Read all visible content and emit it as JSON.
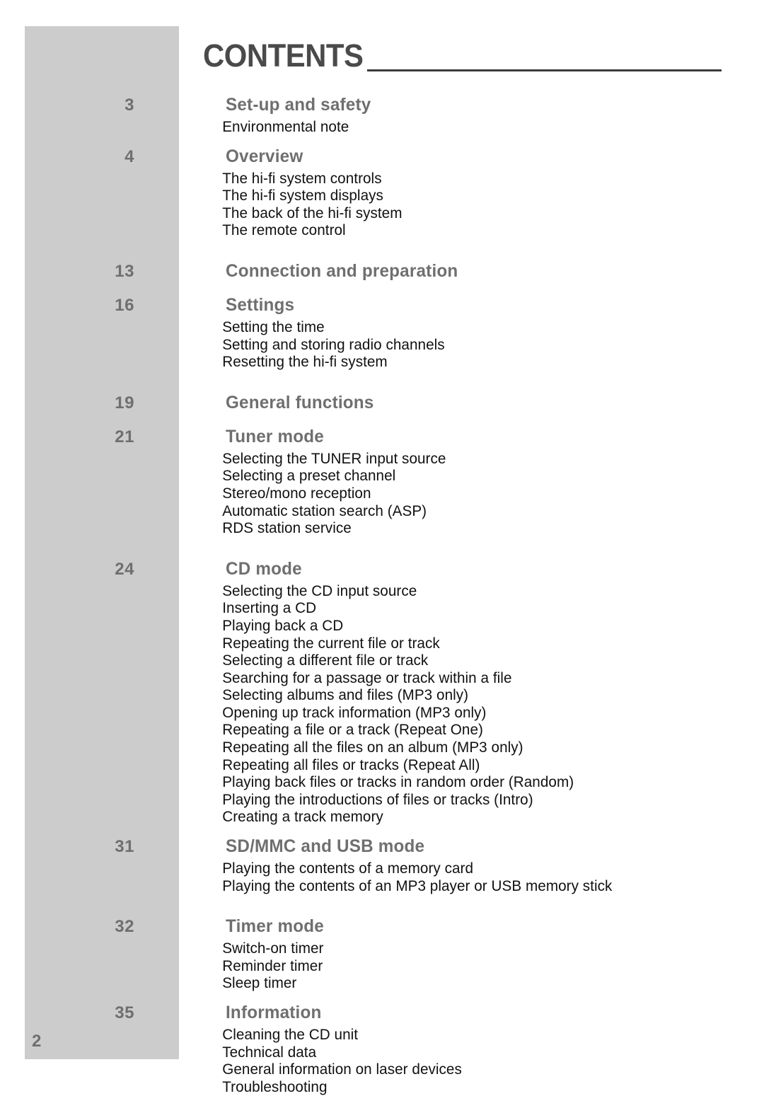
{
  "page": {
    "title": "CONTENTS",
    "folio": "2",
    "band_color": "#cccccc",
    "heading_color": "#6f6f6f",
    "title_color": "#4a4a4a",
    "body_color": "#111111"
  },
  "toc": {
    "groups": [
      {
        "page": "3",
        "title": "Set-up and safety",
        "items": [
          "Environmental note"
        ]
      },
      {
        "page": "4",
        "title": "Overview",
        "items": [
          "The hi-fi system controls",
          "The hi-fi system displays",
          "The back of the hi-fi system",
          "The remote control"
        ]
      },
      {
        "page": "13",
        "title": "Connection and preparation",
        "items": []
      },
      {
        "page": "16",
        "title": "Settings",
        "items": [
          "Setting the time",
          "Setting and storing radio channels",
          "Resetting the hi-fi system"
        ]
      },
      {
        "page": "19",
        "title": "General functions",
        "items": []
      },
      {
        "page": "21",
        "title": "Tuner mode",
        "items": [
          "Selecting the TUNER input source",
          "Selecting a preset channel",
          "Stereo/mono reception",
          "Automatic station search (ASP)",
          "RDS station service"
        ]
      },
      {
        "page": "24",
        "title": "CD mode",
        "items": [
          "Selecting the CD input source",
          "Inserting a CD",
          "Playing back a CD",
          "Repeating the current file or track",
          "Selecting a different file or track",
          "Searching for a passage or track within a file",
          "Selecting albums and files (MP3 only)",
          "Opening up track information (MP3 only)",
          "Repeating a file or a track (Repeat One)",
          "Repeating all the files on an album (MP3 only)",
          "Repeating all files or tracks (Repeat All)",
          "Playing back files or tracks in random order (Random)",
          "Playing the introductions of files or tracks (Intro)",
          "Creating a track memory"
        ]
      },
      {
        "page": "31",
        "title": "SD/MMC and USB mode",
        "items": [
          "Playing the contents of a memory card",
          "Playing the contents of an MP3 player or USB memory stick"
        ]
      },
      {
        "page": "32",
        "title": "Timer mode",
        "items": [
          "Switch-on timer",
          "Reminder timer",
          "Sleep timer"
        ]
      },
      {
        "page": "35",
        "title": "Information",
        "items": [
          "Cleaning the CD unit",
          "Technical data",
          "General information on laser devices",
          "Troubleshooting"
        ]
      }
    ]
  }
}
